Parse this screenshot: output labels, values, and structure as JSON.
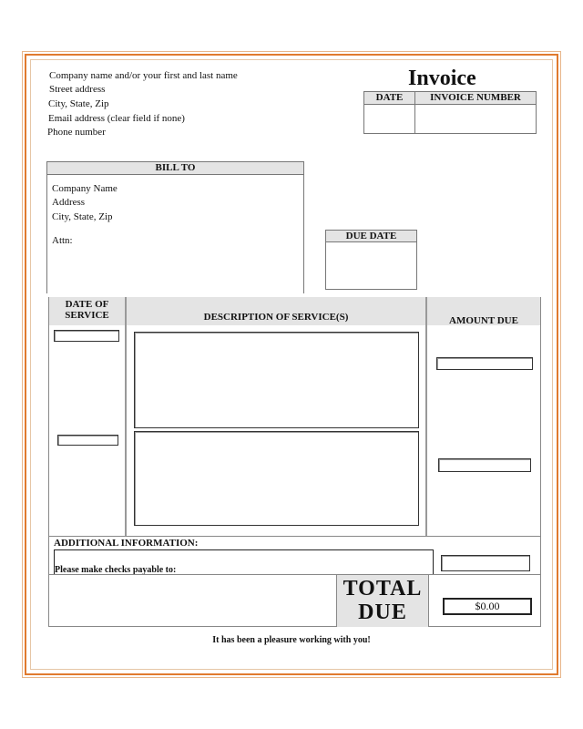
{
  "sender": {
    "company": "Company name and/or your first and last name",
    "street": "Street address",
    "city": "City, State, Zip",
    "email": "Email address (clear field if none)",
    "phone": "Phone number"
  },
  "title": "Invoice",
  "meta_table": {
    "date_label": "DATE",
    "invoice_number_label": "INVOICE NUMBER",
    "date_value": "",
    "invoice_number_value": ""
  },
  "bill_to": {
    "header": "BILL TO",
    "company": "Company Name",
    "address": "Address",
    "city": "City, State, Zip",
    "attn": "Attn:"
  },
  "due_date": {
    "header": "DUE DATE",
    "value": ""
  },
  "services_table": {
    "columns": [
      "DATE OF SERVICE",
      "DESCRIPTION OF SERVICE(S)",
      "AMOUNT DUE"
    ],
    "col_date_line1": "DATE OF",
    "col_date_line2": "SERVICE",
    "rows": [
      {
        "date": "",
        "description": "",
        "amount": ""
      },
      {
        "date": "",
        "description": "",
        "amount": ""
      }
    ]
  },
  "additional": {
    "label": "ADDITIONAL INFORMATION:",
    "checks_payable": "Please make checks payable to:",
    "value": "",
    "extra_amount": ""
  },
  "total": {
    "label_line1": "TOTAL",
    "label_line2": "DUE",
    "value": "$0.00"
  },
  "footer": {
    "message": "It has been a pleasure working with you!"
  },
  "colors": {
    "border_orange": "#e07a2e",
    "header_gray": "#e4e4e4"
  }
}
